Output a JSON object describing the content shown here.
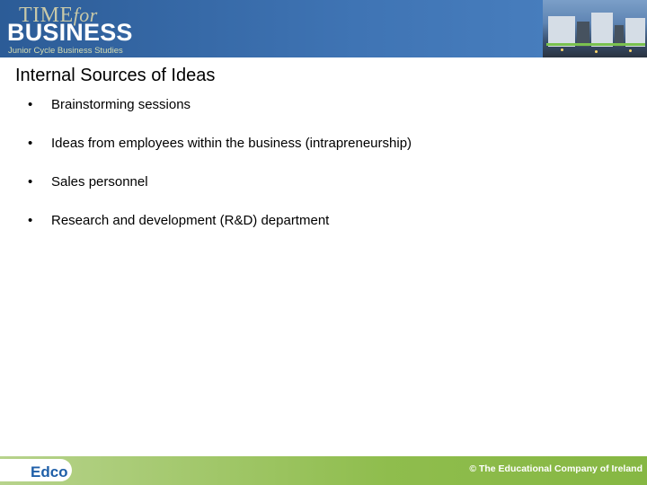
{
  "header": {
    "logo_time": "TIME",
    "logo_for": "for",
    "logo_business": "BUSINESS",
    "logo_subtitle": "Junior Cycle Business Studies"
  },
  "slide": {
    "title": "Internal Sources of Ideas",
    "bullets": [
      "Brainstorming sessions",
      "Ideas from employees within the business (intrapreneurship)",
      "Sales personnel",
      "Research and development (R&D) department"
    ],
    "bullet_symbol": "•"
  },
  "footer": {
    "publisher_logo": "Edco",
    "copyright": "© The Educational Company of Ireland"
  },
  "colors": {
    "header_blue": "#3f74b4",
    "footer_green": "#8fbd4d",
    "edco_blue": "#1f5fa8"
  }
}
